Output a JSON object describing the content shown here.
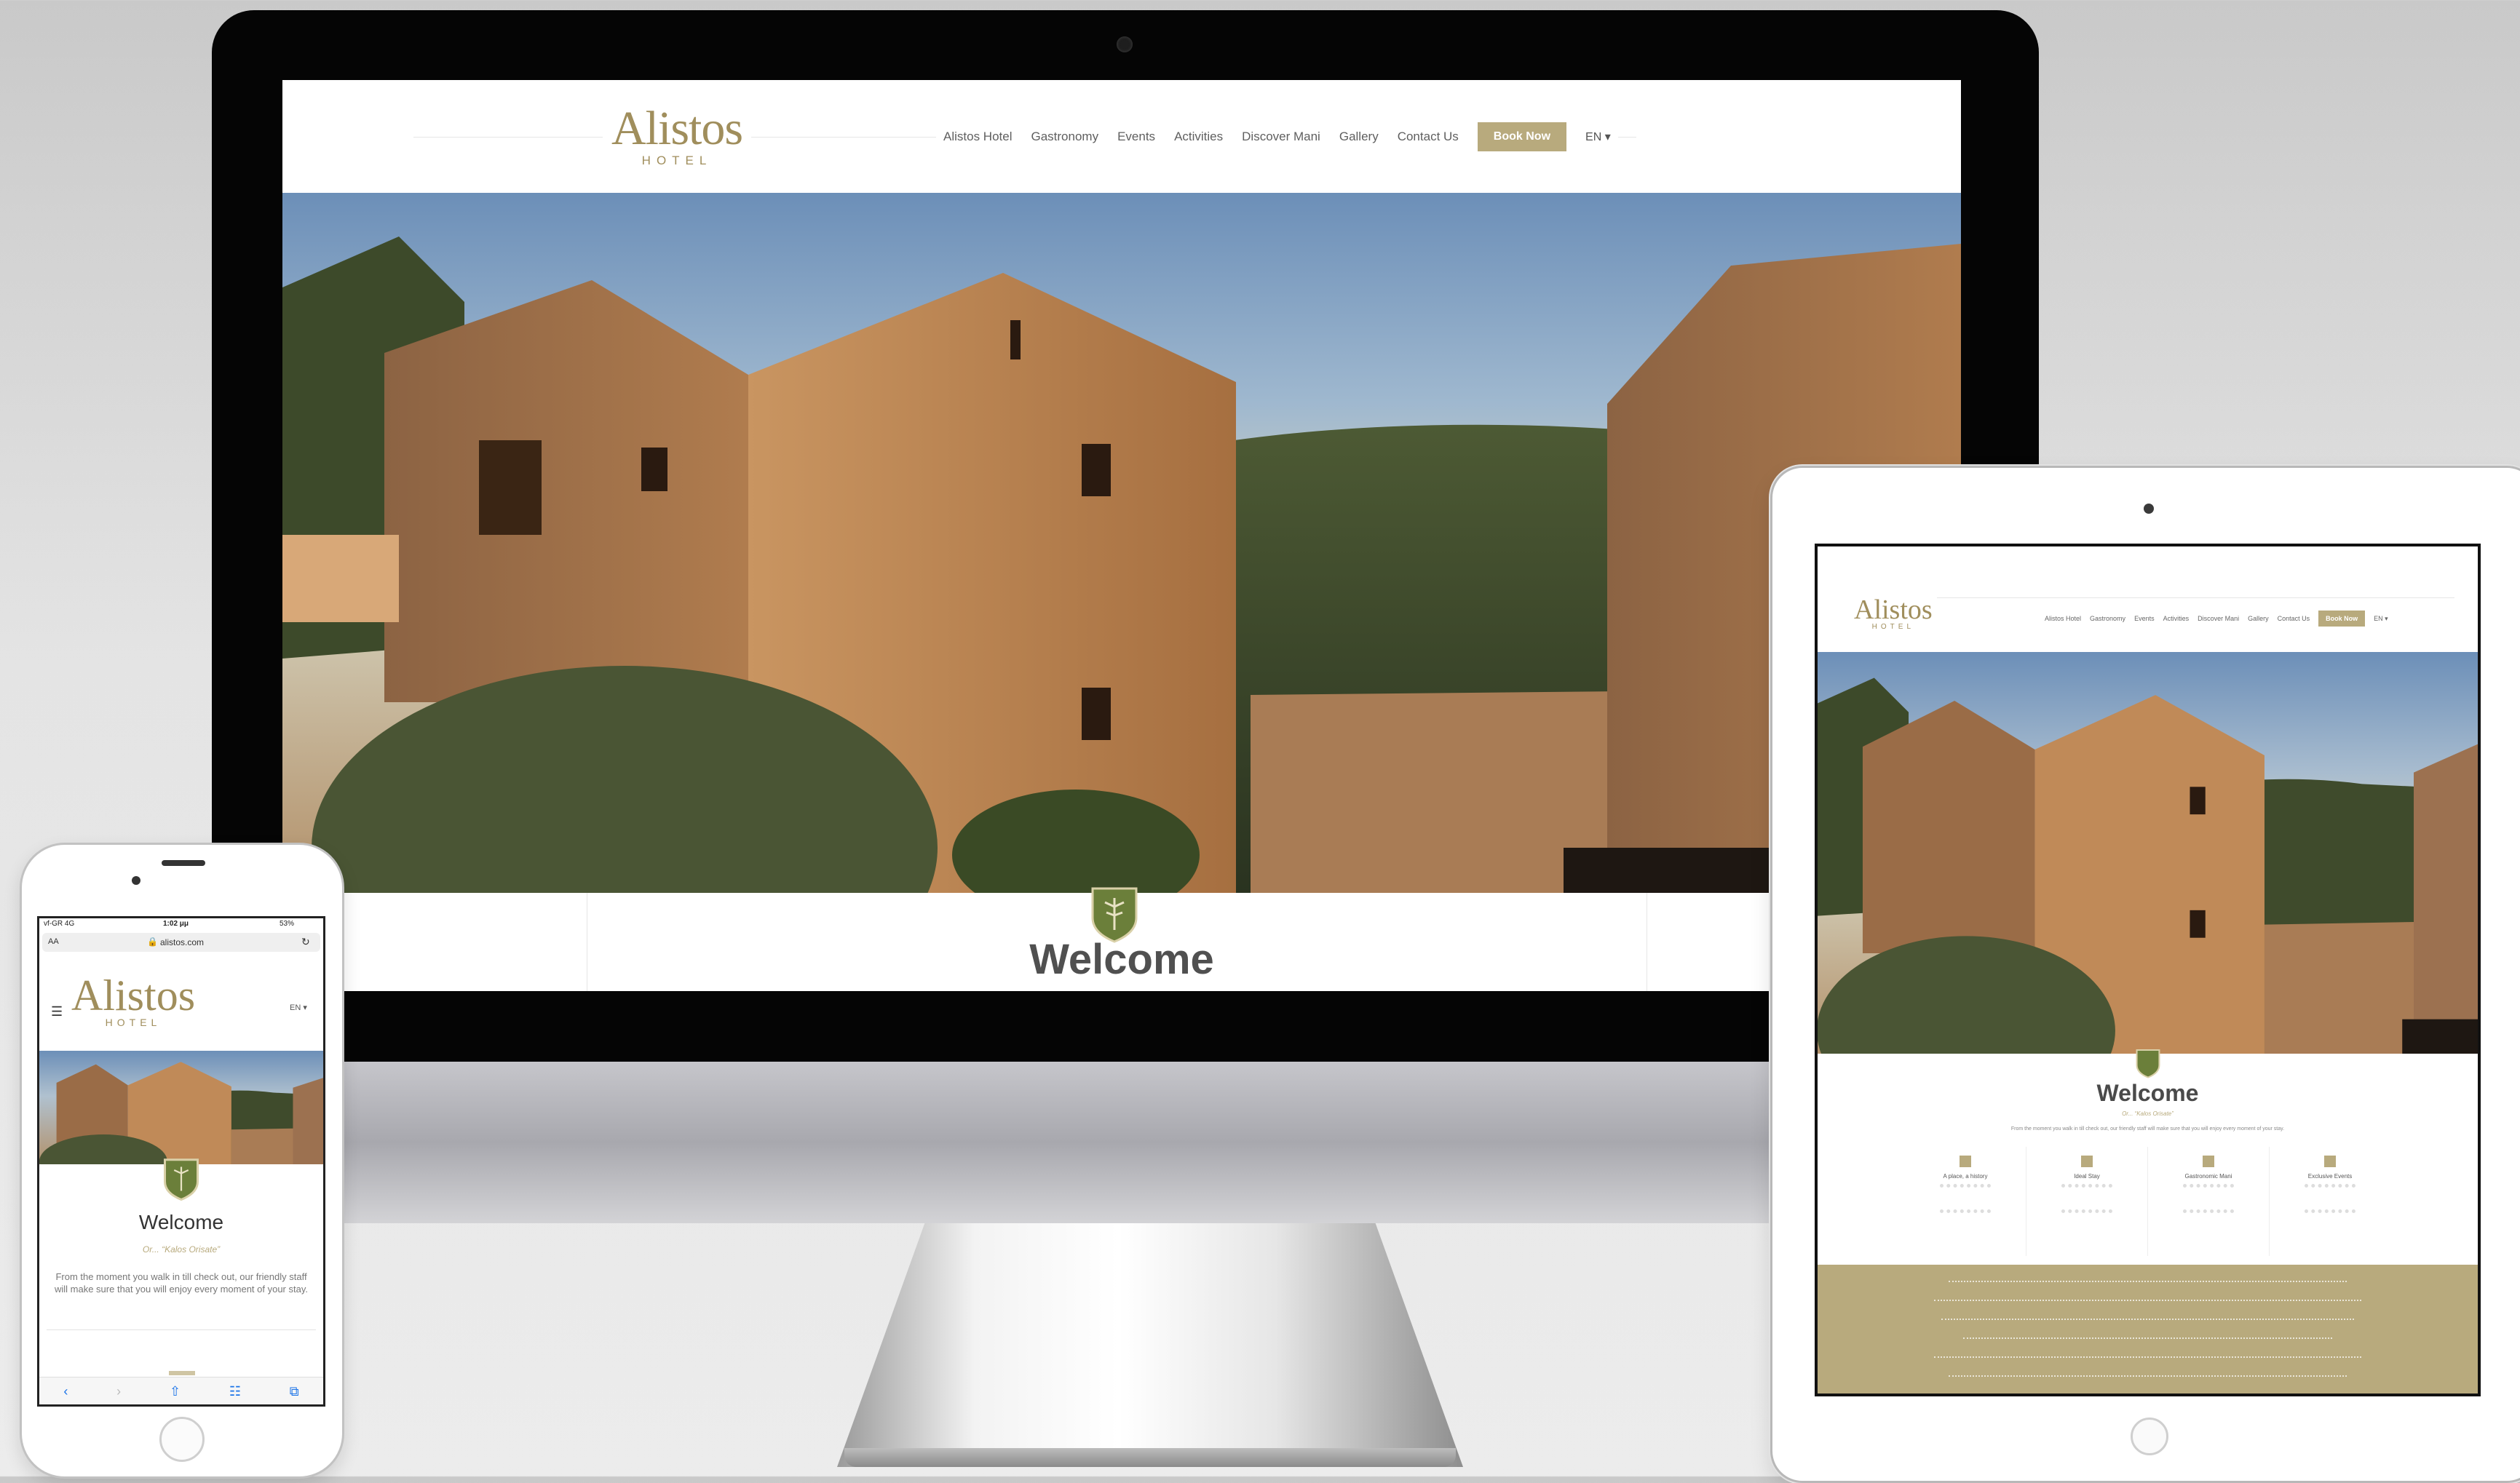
{
  "brand": {
    "name": "Alistos",
    "subtitle": "HOTEL",
    "gold": "#b8aa7d",
    "text": "#a08e5c"
  },
  "nav": {
    "items": [
      "Alistos Hotel",
      "Gastronomy",
      "Events",
      "Activities",
      "Discover Mani",
      "Gallery",
      "Contact Us"
    ],
    "book": "Book Now",
    "lang": "EN ▾"
  },
  "welcome": {
    "title": "Welcome",
    "tagline": "Or... “Kalos Orisate”",
    "intro": "From the moment you walk in till check out, our friendly staff will make sure that you will enjoy every moment of your stay."
  },
  "tablet_features": [
    {
      "title": "A place, a history",
      "icon": "history-icon"
    },
    {
      "title": "Ideal Stay",
      "icon": "star-icon"
    },
    {
      "title": "Gastronomic Mani",
      "icon": "dish-icon"
    },
    {
      "title": "Exclusive Events",
      "icon": "event-icon"
    }
  ],
  "phone_status": {
    "carrier": "vf-GR 4G",
    "time": "1:02 μμ",
    "battery": "53%"
  },
  "phone_browser": {
    "text_size": "AA",
    "url": "alistos.com",
    "reload_icon": "reload-icon",
    "lock_icon": "lock-icon"
  },
  "phone_menu_icon": "hamburger-menu-icon",
  "phone_toolbar": [
    "back-icon",
    "forward-icon",
    "share-icon",
    "bookmarks-icon",
    "tabs-icon"
  ]
}
